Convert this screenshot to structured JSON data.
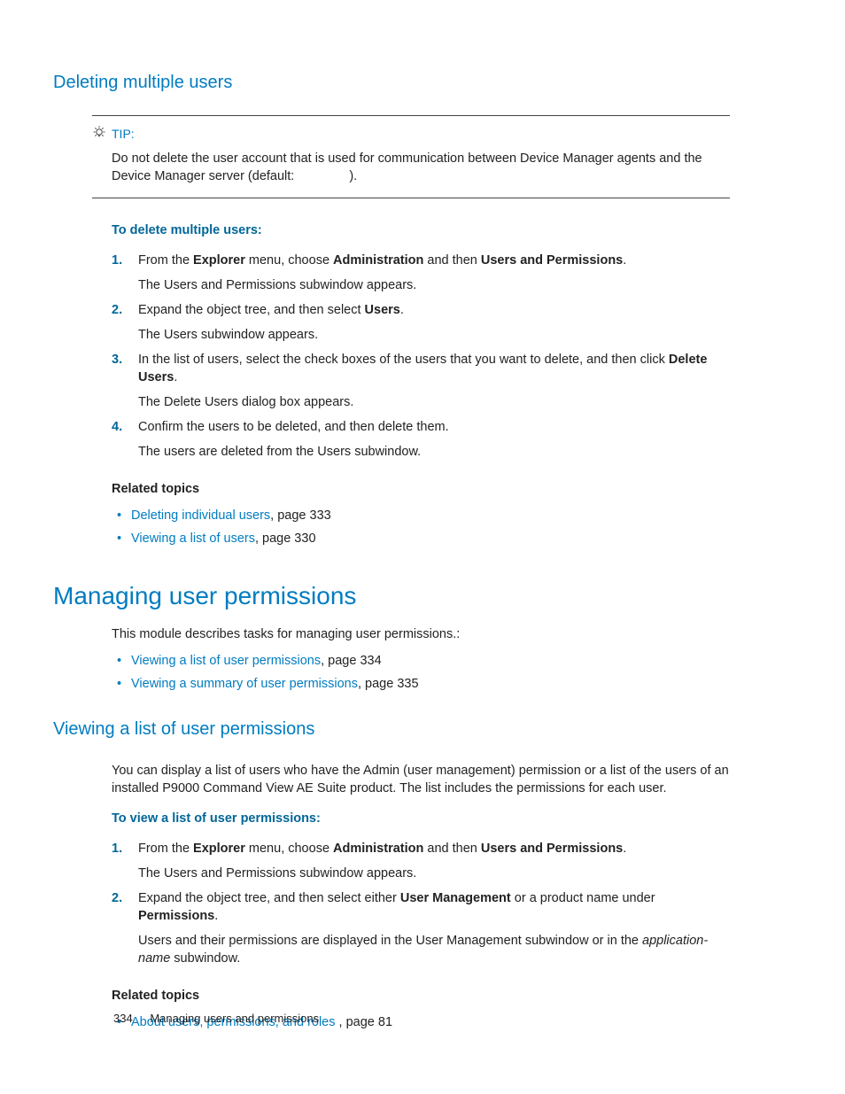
{
  "section1": {
    "heading": "Deleting multiple users",
    "tip": {
      "label": "TIP:",
      "body_pre": "Do not delete the user account that is used for communication between Device Manager agents and the Device Manager server (default: ",
      "body_post": ")."
    },
    "procHead": "To delete multiple users:",
    "steps": [
      {
        "num": "1.",
        "line_html": "From the <span class=\"bold\">Explorer</span> menu, choose <span class=\"bold\">Administration</span> and then <span class=\"bold\">Users and Permissions</span>.",
        "after": "The Users and Permissions subwindow appears."
      },
      {
        "num": "2.",
        "line_html": "Expand the object tree, and then select <span class=\"bold\">Users</span>.",
        "after": "The Users subwindow appears."
      },
      {
        "num": "3.",
        "line_html": "In the list of users, select the check boxes of the users that you want to delete, and then click <span class=\"bold\">Delete Users</span>.",
        "after": "The Delete Users dialog box appears."
      },
      {
        "num": "4.",
        "line_html": "Confirm the users to be deleted, and then delete them.",
        "after": "The users are deleted from the Users subwindow."
      }
    ],
    "relatedHead": "Related topics",
    "related": [
      {
        "link": "Deleting individual users",
        "suffix": ", page 333"
      },
      {
        "link": "Viewing a list of users",
        "suffix": ", page 330"
      }
    ]
  },
  "section2": {
    "heading": "Managing user permissions",
    "intro": "This module describes tasks for managing user permissions.:",
    "toc": [
      {
        "link": "Viewing a list of user permissions",
        "suffix": ", page 334"
      },
      {
        "link": "Viewing a summary of user permissions",
        "suffix": ", page 335"
      }
    ]
  },
  "section3": {
    "heading": "Viewing a list of user permissions",
    "intro": "You can display a list of users who have the Admin (user management) permission or a list of the users of an installed P9000 Command View AE Suite product. The list includes the permissions for each user.",
    "procHead": "To view a list of user permissions:",
    "steps": [
      {
        "num": "1.",
        "line_html": "From the <span class=\"bold\">Explorer</span> menu, choose <span class=\"bold\">Administration</span> and then <span class=\"bold\">Users and Permissions</span>.",
        "after": "The Users and Permissions subwindow appears."
      },
      {
        "num": "2.",
        "line_html": "Expand the object tree, and then select either <span class=\"bold\">User Management</span> or a product name under <span class=\"bold\">Permissions</span>.",
        "after_html": "Users and their permissions are displayed in the User Management subwindow or in the <span class=\"ital\">application-name</span> subwindow."
      }
    ],
    "relatedHead": "Related topics",
    "related": [
      {
        "link": "About users, permissions, and roles ",
        "suffix": ", page 81"
      }
    ]
  },
  "footer": {
    "page": "334",
    "title": "Managing users and permissions"
  }
}
